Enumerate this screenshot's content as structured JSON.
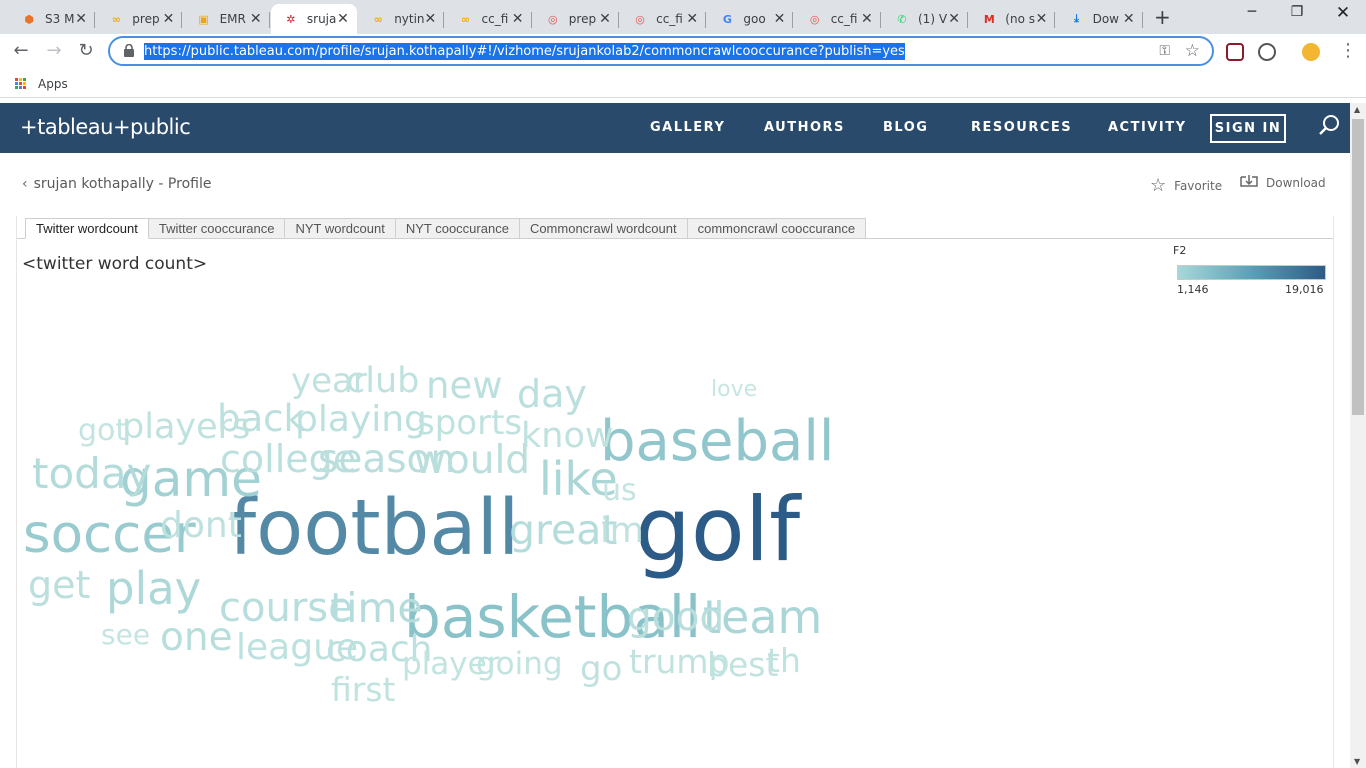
{
  "browser": {
    "tabs": [
      {
        "title": "S3 M",
        "favicon": "aws-s3-icon",
        "color": "#e8742a",
        "glyph": "⬢"
      },
      {
        "title": "prep",
        "favicon": "colab-icon",
        "color": "#f9ab00",
        "glyph": "∞"
      },
      {
        "title": "EMR",
        "favicon": "aws-emr-icon",
        "color": "#f0a30a",
        "glyph": "▣"
      },
      {
        "title": "sruja",
        "favicon": "tableau-icon",
        "color": "#c72037",
        "glyph": "✲",
        "active": true
      },
      {
        "title": "nytin",
        "favicon": "colab-icon",
        "color": "#f9ab00",
        "glyph": "∞"
      },
      {
        "title": "cc_fi",
        "favicon": "colab-icon",
        "color": "#f9ab00",
        "glyph": "∞"
      },
      {
        "title": "prep",
        "favicon": "jupyter-icon",
        "color": "#e4544b",
        "glyph": "◎"
      },
      {
        "title": "cc_fi",
        "favicon": "jupyter-icon",
        "color": "#e4544b",
        "glyph": "◎"
      },
      {
        "title": "goo",
        "favicon": "google-icon",
        "color": "#4285f4",
        "glyph": "G"
      },
      {
        "title": "cc_fi",
        "favicon": "jupyter-icon",
        "color": "#e4544b",
        "glyph": "◎"
      },
      {
        "title": "(1) V",
        "favicon": "whatsapp-icon",
        "color": "#25d366",
        "glyph": "✆"
      },
      {
        "title": "(no s",
        "favicon": "gmail-icon",
        "color": "#d93025",
        "glyph": "M"
      },
      {
        "title": "Dow",
        "favicon": "download-icon",
        "color": "#1a73e8",
        "glyph": "⤓"
      }
    ],
    "url": "https://public.tableau.com/profile/srujan.kothapally#!/vizhome/srujankolab2/commoncrawlcooccurance?publish=yes",
    "bookmarks_apps": "Apps"
  },
  "site": {
    "logo": "+tableau+public",
    "nav": [
      "GALLERY",
      "AUTHORS",
      "BLOG",
      "RESOURCES",
      "ACTIVITY"
    ],
    "signin": "SIGN IN",
    "back_link": "srujan kothapally - Profile",
    "favorite": "Favorite",
    "download": "Download"
  },
  "viz": {
    "tabs": [
      "Twitter wordcount",
      "Twitter cooccurance",
      "NYT wordcount",
      "NYT cooccurance",
      "Commoncrawl wordcount",
      "commoncrawl cooccurance"
    ],
    "active_tab": 0,
    "sheet_title": "<twitter word count>",
    "legend": {
      "title": "F2",
      "min": "1,146",
      "max": "19,016",
      "color_min": "#a6d8d8",
      "color_max": "#2c5b87"
    }
  },
  "chart_data": {
    "type": "wordcloud",
    "title": "<twitter word count>",
    "color_field": "F2",
    "color_range": [
      1146,
      19016
    ],
    "words": [
      {
        "text": "golf",
        "value": 19016
      },
      {
        "text": "football",
        "value": 13500
      },
      {
        "text": "basketball",
        "value": 6500
      },
      {
        "text": "baseball",
        "value": 5800
      },
      {
        "text": "soccer",
        "value": 5200
      },
      {
        "text": "game",
        "value": 4300
      },
      {
        "text": "like",
        "value": 3600
      },
      {
        "text": "team",
        "value": 3500
      },
      {
        "text": "play",
        "value": 3300
      },
      {
        "text": "today",
        "value": 2800
      },
      {
        "text": "great",
        "value": 2700
      },
      {
        "text": "time",
        "value": 2600
      },
      {
        "text": "course",
        "value": 2500
      },
      {
        "text": "one",
        "value": 2400
      },
      {
        "text": "good",
        "value": 2300
      },
      {
        "text": "season",
        "value": 2300
      },
      {
        "text": "would",
        "value": 2300
      },
      {
        "text": "college",
        "value": 2200
      },
      {
        "text": "get",
        "value": 2200
      },
      {
        "text": "day",
        "value": 2200
      },
      {
        "text": "new",
        "value": 2100
      },
      {
        "text": "back",
        "value": 2100
      },
      {
        "text": "playing",
        "value": 2000
      },
      {
        "text": "coach",
        "value": 2000
      },
      {
        "text": "league",
        "value": 1900
      },
      {
        "text": "dont",
        "value": 1900
      },
      {
        "text": "im",
        "value": 1800
      },
      {
        "text": "players",
        "value": 1800
      },
      {
        "text": "club",
        "value": 1800
      },
      {
        "text": "know",
        "value": 1800
      },
      {
        "text": "sports",
        "value": 1700
      },
      {
        "text": "year",
        "value": 1700
      },
      {
        "text": "go",
        "value": 1700
      },
      {
        "text": "first",
        "value": 1600
      },
      {
        "text": "trump",
        "value": 1600
      },
      {
        "text": "best",
        "value": 1600
      },
      {
        "text": "th",
        "value": 1600
      },
      {
        "text": "player",
        "value": 1500
      },
      {
        "text": "going",
        "value": 1500
      },
      {
        "text": "got",
        "value": 1400
      },
      {
        "text": "us",
        "value": 1400
      },
      {
        "text": "see",
        "value": 1300
      },
      {
        "text": "love",
        "value": 1146
      }
    ]
  }
}
